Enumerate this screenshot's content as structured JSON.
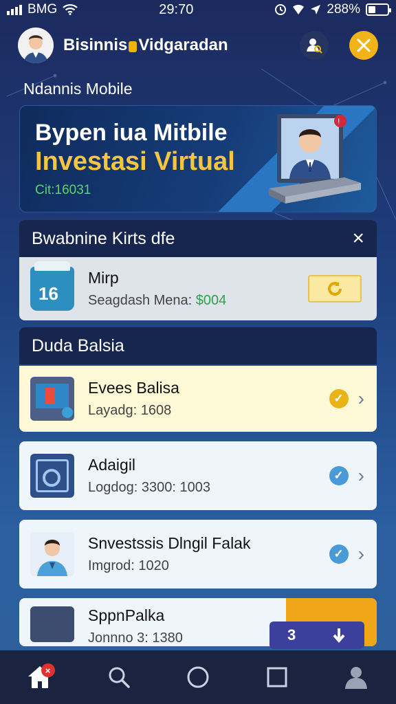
{
  "status": {
    "carrier": "BMG",
    "time": "29:70",
    "battery": "288%"
  },
  "header": {
    "title_part1": "Bisinnis",
    "title_part2": "Vidgaradan"
  },
  "section_label": "Ndannis Mobile",
  "hero": {
    "line1": "Bypen iua Mitbile",
    "line2": "Investasi Virtual",
    "meta": "Cit:16031"
  },
  "panel1": {
    "title": "Bwabnine Kirts dfe",
    "close": "×",
    "card": {
      "title": "Mirp",
      "subtitle_text": "Seagdash Mena: ",
      "subtitle_value": "$004",
      "icon_text": "16"
    }
  },
  "panel2": {
    "title": "Duda Balsia"
  },
  "items": [
    {
      "title": "Evees Balisa",
      "subtitle": "Layadg: 1608"
    },
    {
      "title": "Adaigil",
      "subtitle": "Logdog: 3300: 1003"
    },
    {
      "title": "Snvestssis Dlngil Falak",
      "subtitle": "Imgrod: 1020"
    },
    {
      "title": "SppnPalka",
      "subtitle": "Jonnno 3: 1380"
    }
  ],
  "float_button": {
    "label": "3"
  },
  "colors": {
    "accent_gold": "#f4c542",
    "check_yellow": "#e8b417",
    "check_blue": "#4a9ad8",
    "green": "#2ca24a"
  }
}
